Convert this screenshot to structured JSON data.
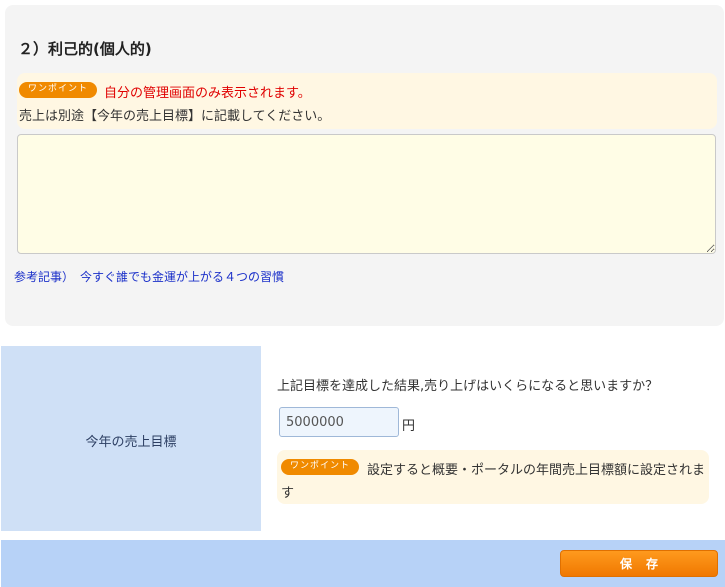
{
  "section": {
    "heading": "２）利己的(個人的)",
    "hint": {
      "badge": "ワンポイント",
      "line1": "自分の管理画面のみ表示されます。",
      "line2": "売上は別途【今年の売上目標】に記載してください。"
    },
    "textarea_value": "",
    "reference_link": "参考記事）　今すぐ誰でも金運が上がる４つの習慣"
  },
  "sales_goal": {
    "label": "今年の売上目標",
    "question": "上記目標を達成した結果,売り上げはいくらになると思いますか？",
    "amount_value": "5000000",
    "unit": "円",
    "hint": {
      "badge": "ワンポイント",
      "text": "設定すると概要・ポータルの年間売上目標額に設定されます"
    }
  },
  "footer": {
    "save_label": "保存"
  },
  "colors": {
    "accent_orange": "#f08a00",
    "hint_bg": "#fff7e3",
    "label_cell_bg": "#cfe0f6",
    "footer_bg": "#b7d2f7",
    "link": "#1a2fc9",
    "warning_text": "#e00000"
  }
}
